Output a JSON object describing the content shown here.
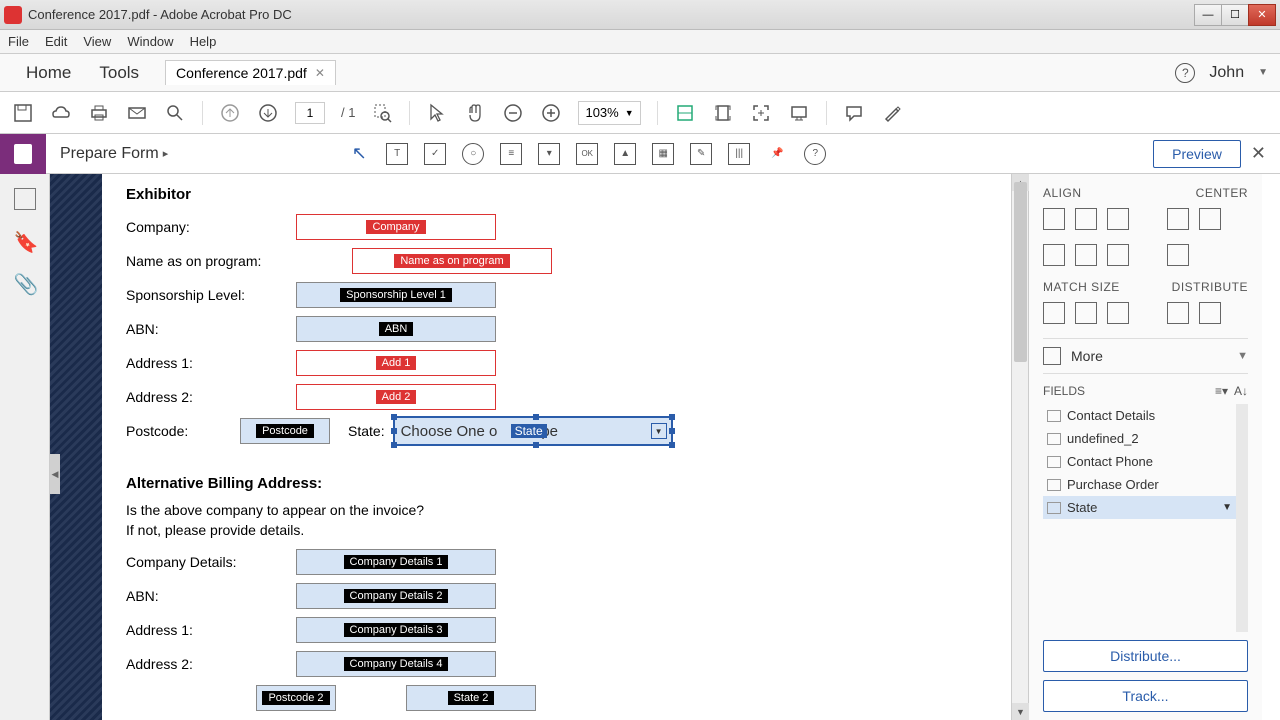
{
  "titlebar": {
    "title": "Conference 2017.pdf - Adobe Acrobat Pro DC"
  },
  "menu": {
    "file": "File",
    "edit": "Edit",
    "view": "View",
    "window": "Window",
    "help": "Help"
  },
  "tabs": {
    "home": "Home",
    "tools": "Tools",
    "doc": "Conference 2017.pdf",
    "user": "John"
  },
  "toolbar": {
    "page_current": "1",
    "page_total": "/ 1",
    "zoom": "103%"
  },
  "prepbar": {
    "label": "Prepare Form",
    "preview": "Preview"
  },
  "form": {
    "section1": "Exhibitor",
    "company_lbl": "Company:",
    "company_tag": "Company",
    "name_lbl": "Name as on program:",
    "name_tag": "Name as on program",
    "spons_lbl": "Sponsorship Level:",
    "spons_tag": "Sponsorship Level 1",
    "abn_lbl": "ABN:",
    "abn_tag": "ABN",
    "addr1_lbl": "Address 1:",
    "addr1_tag": "Add 1",
    "addr2_lbl": "Address 2:",
    "addr2_tag": "Add 2",
    "postcode_lbl": "Postcode:",
    "postcode_tag": "Postcode",
    "state_lbl": "State:",
    "state_value": "Choose One o",
    "state_tag": "State",
    "state_suffix": "pe",
    "section2": "Alternative Billing Address:",
    "q1": "Is the above company to appear on the invoice?",
    "q2": "If not, please provide details.",
    "cd_lbl": "Company Details:",
    "cd1": "Company Details 1",
    "abn2_lbl": "ABN:",
    "cd2": "Company Details 2",
    "addr1b_lbl": "Address 1:",
    "cd3": "Company Details 3",
    "addr2b_lbl": "Address 2:",
    "cd4": "Company Details 4",
    "postcode2_tag": "Postcode 2",
    "state2_tag": "State 2"
  },
  "rightpanel": {
    "align": "ALIGN",
    "center": "CENTER",
    "matchsize": "MATCH SIZE",
    "distribute": "DISTRIBUTE",
    "more": "More",
    "fields": "FIELDS",
    "items": [
      "Contact Details",
      "undefined_2",
      "Contact Phone",
      "Purchase Order",
      "State"
    ],
    "distribute_btn": "Distribute...",
    "track_btn": "Track..."
  }
}
